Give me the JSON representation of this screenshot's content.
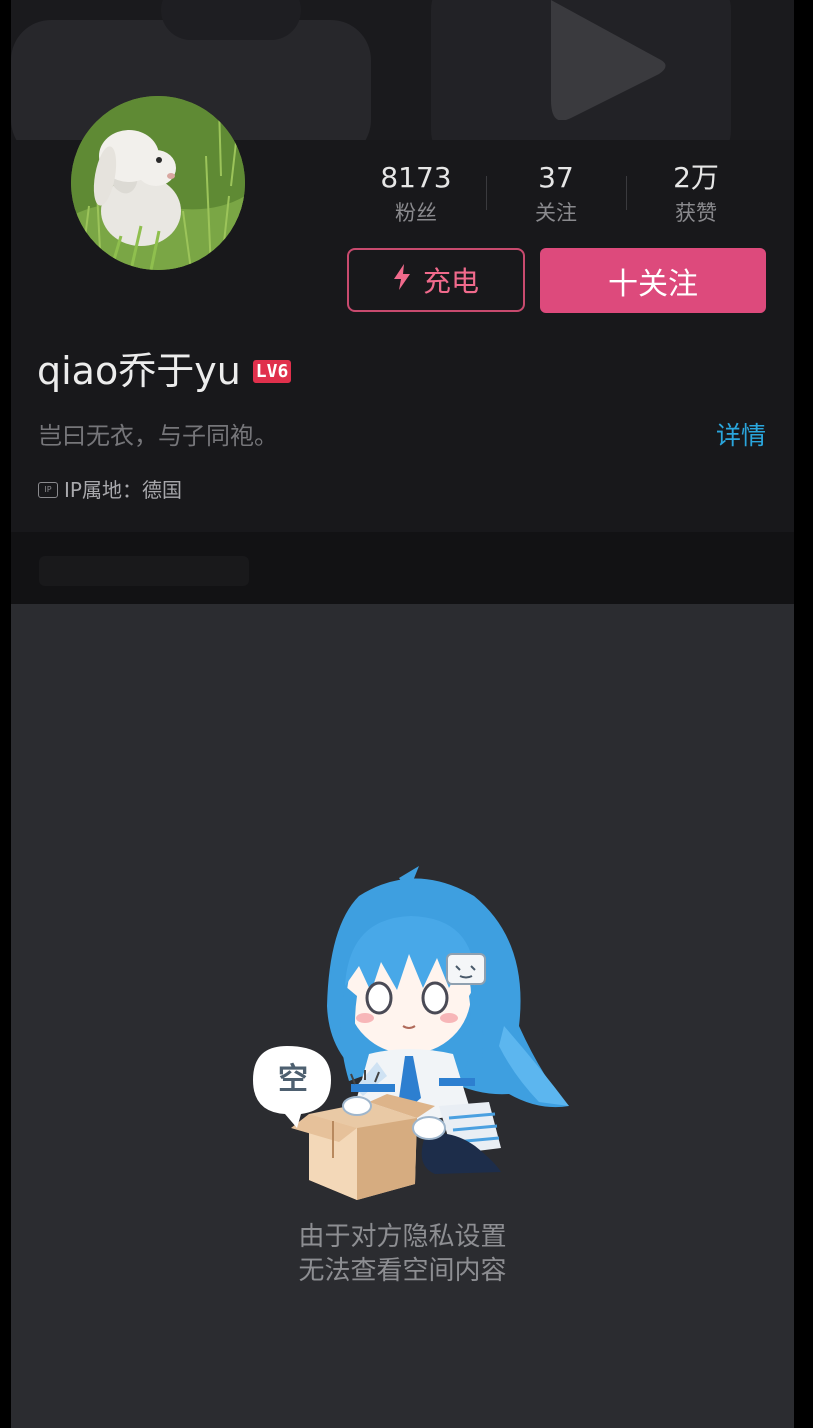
{
  "profile": {
    "username": "qiao乔于yu",
    "level_badge": "LV6",
    "bio": "岂曰无衣，与子同袍。",
    "detail_label": "详情",
    "ip_icon_text": "IP",
    "ip_location": "IP属地：德国",
    "avatar_icon": "rabbit-in-grass-photo"
  },
  "stats": [
    {
      "value": "8173",
      "label": "粉丝"
    },
    {
      "value": "37",
      "label": "关注"
    },
    {
      "value": "2万",
      "label": "获赞"
    }
  ],
  "actions": {
    "charge_label": "充电",
    "charge_icon": "lightning-icon",
    "follow_label": "十关注"
  },
  "empty_state": {
    "bubble_text": "空",
    "line1": "由于对方隐私设置",
    "line2": "无法查看空间内容"
  },
  "colors": {
    "accent_pink": "#dd4a7c",
    "link_blue": "#2aa6dd",
    "level_red": "#e0304c",
    "background": "#2b2c30"
  }
}
